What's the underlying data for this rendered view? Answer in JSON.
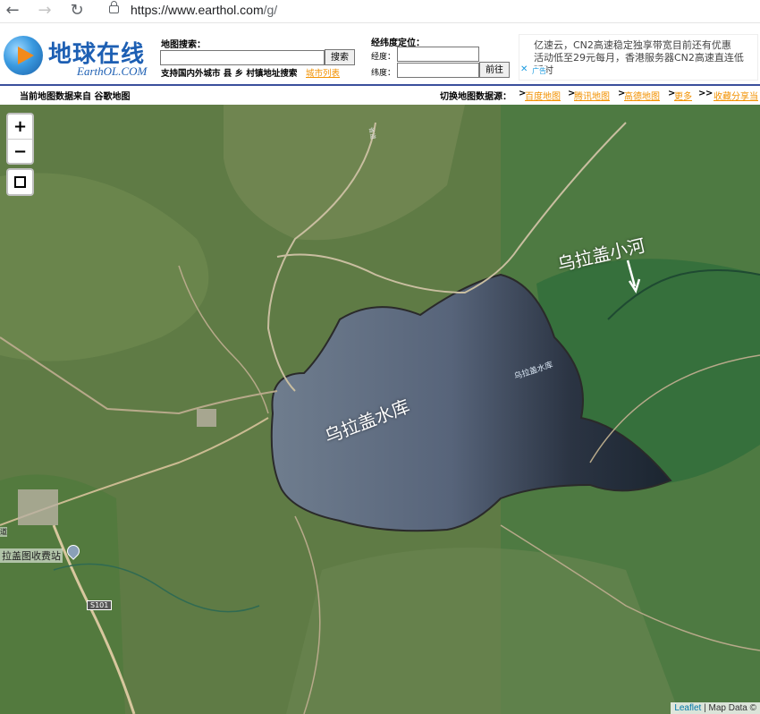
{
  "browser": {
    "back_icon": "arrow-left-icon",
    "forward_icon": "arrow-right-icon",
    "reload_icon": "reload-icon",
    "lock_icon": "lock-icon",
    "url_host": "https://www.earthol.com",
    "url_path": "/g/"
  },
  "header": {
    "logo_text": "地球在线",
    "logo_sub": "EarthOL.COM",
    "search_label": "地图搜索：",
    "search_value": "",
    "search_button": "搜索",
    "search_hint": "支持国内外城市 县 乡 村镇地址搜索",
    "city_list_link": "城市列表",
    "coord_title": "经纬度定位：",
    "lng_label": "经度：",
    "lat_label": "纬度：",
    "lng_value": "",
    "lat_value": "",
    "go_button": "前往",
    "ad_line1": "亿速云，CN2高速稳定独享带宽目前还有优惠",
    "ad_line2": "活动低至29元每月，香港服务器CN2高速直连低",
    "ad_line3": "延时",
    "ad_close": "✕",
    "ad_tag": "广告"
  },
  "info_bar": {
    "source_text": "当前地图数据来自 谷歌地图",
    "switch_label": "切换地图数据源：",
    "links": [
      "百度地图",
      "腾讯地图",
      "高德地图",
      "更多",
      "收藏分享当"
    ],
    "separator": ">"
  },
  "map": {
    "zoom_in": "+",
    "zoom_out": "−",
    "fullscreen_icon": "fullscreen-icon",
    "lake_label": "乌拉盖水库",
    "lake_small_label": "乌拉盖水库",
    "river_label": "乌拉盖小河",
    "river_arrow": "↓",
    "toll_label": "拉盖图收费站",
    "road_label_s101": "S101",
    "road_label_left": "道",
    "road_label_top": "省道",
    "attribution_leaflet": "Leaflet",
    "attribution_rest": " | Map Data ©"
  }
}
